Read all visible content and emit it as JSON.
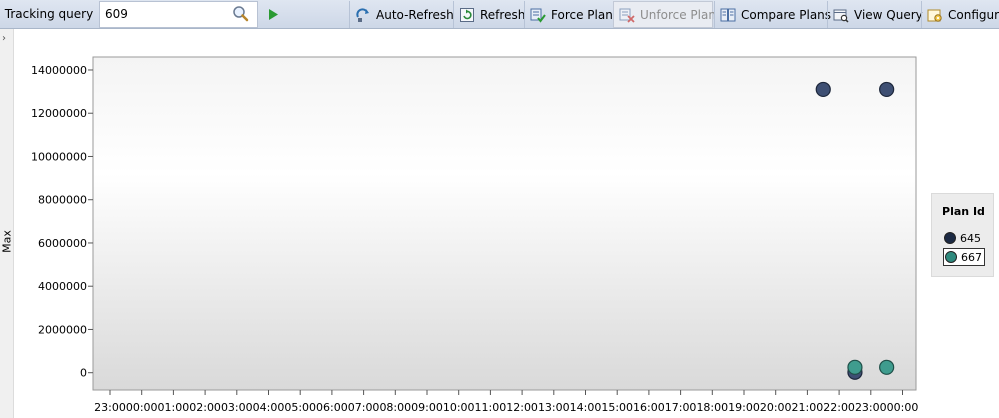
{
  "toolbar": {
    "tracking_label": "Tracking query",
    "tracking_value": "609",
    "buttons": [
      {
        "label": "Auto-Refresh",
        "icon": "auto-refresh-icon"
      },
      {
        "label": "Refresh",
        "icon": "refresh-icon"
      },
      {
        "label": "Force Plan",
        "icon": "force-plan-icon"
      },
      {
        "label": "Unforce Plan",
        "icon": "unforce-plan-icon",
        "disabled": true
      },
      {
        "label": "Compare Plans",
        "icon": "compare-plans-icon"
      },
      {
        "label": "View Query",
        "icon": "view-query-icon"
      },
      {
        "label": "Configure",
        "icon": "configure-icon"
      }
    ]
  },
  "colors": {
    "plan_645": "#3a4a6b",
    "plan_667": "#3e9a8c",
    "toolbar_bg": "#d6dfec"
  },
  "chart_data": {
    "type": "scatter",
    "ylabel": "Max",
    "ylim": [
      -800000,
      14600000
    ],
    "yticks": [
      0,
      2000000,
      4000000,
      6000000,
      8000000,
      10000000,
      12000000,
      14000000
    ],
    "ytick_labels": [
      "0",
      "2000000",
      "4000000",
      "6000000",
      "8000000",
      "10000000",
      "12000000",
      "14000000"
    ],
    "xtick_labels": [
      "23:00",
      "00:00",
      "01:00",
      "02:00",
      "03:00",
      "04:00",
      "05:00",
      "06:00",
      "07:00",
      "08:00",
      "09:00",
      "10:00",
      "11:00",
      "12:00",
      "13:00",
      "14:00",
      "15:00",
      "16:00",
      "17:00",
      "18:00",
      "19:00",
      "20:00",
      "21:00",
      "22:00",
      "23:00",
      "00:00"
    ],
    "legend_title": "Plan Id",
    "legend_position": "right",
    "grid": false,
    "series": [
      {
        "name": "645",
        "points": [
          {
            "x": "21:30",
            "y": 13100000
          },
          {
            "x": "22:30",
            "y": 20000
          },
          {
            "x": "23:30",
            "y": 13100000
          }
        ]
      },
      {
        "name": "667",
        "points": [
          {
            "x": "22:30",
            "y": 250000
          },
          {
            "x": "23:30",
            "y": 250000
          }
        ]
      }
    ]
  }
}
